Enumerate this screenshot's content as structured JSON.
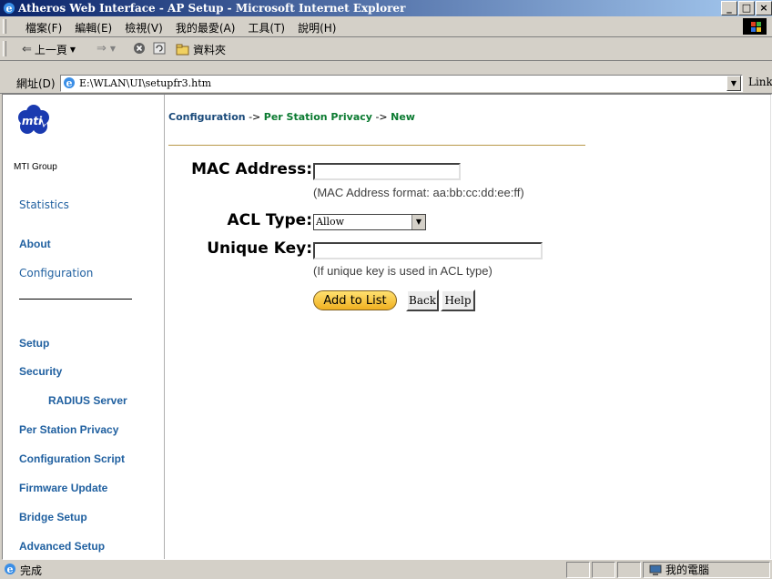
{
  "window": {
    "title": "Atheros Web Interface - AP Setup - Microsoft Internet Explorer",
    "minimize": "_",
    "maximize": "□",
    "close": "×"
  },
  "menu": {
    "items": [
      "檔案(F)",
      "編輯(E)",
      "檢視(V)",
      "我的最愛(A)",
      "工具(T)",
      "說明(H)"
    ]
  },
  "toolbar": {
    "back_label": "上一頁",
    "folders_label": "資料夾"
  },
  "address": {
    "label": "網址(D)",
    "value": "E:\\WLAN\\UI\\setupfr3.htm",
    "links_label": "Links"
  },
  "sidebar": {
    "logo_caption": "MTI Group",
    "logo_text": "mti",
    "top_links": [
      "Statistics",
      "About",
      "Configuration"
    ],
    "sub_links": [
      "Setup",
      "Security",
      "RADIUS Server",
      "Per Station Privacy",
      "Configuration Script",
      "Firmware Update",
      "Bridge Setup",
      "Advanced Setup"
    ]
  },
  "breadcrumb": {
    "part1": "Configuration",
    "sep1": " -> ",
    "part2": "Per Station Privacy",
    "sep2": " -> ",
    "part3": "New"
  },
  "form": {
    "mac_label": "MAC Address:",
    "mac_value": "",
    "mac_hint": "(MAC Address format: aa:bb:cc:dd:ee:ff)",
    "acl_label": "ACL Type:",
    "acl_selected": "Allow",
    "key_label": "Unique Key:",
    "key_value": "",
    "key_hint": "(If unique key is used in ACL type)",
    "add_button": "Add to List",
    "back_button": "Back",
    "help_button": "Help"
  },
  "status": {
    "left_text": "完成",
    "zone_text": "我的電腦"
  },
  "colors": {
    "link": "#2060a0",
    "breadcrumb_green": "#0a7a30",
    "titlebar_start": "#0a246a",
    "add_button": "#f0b020"
  }
}
